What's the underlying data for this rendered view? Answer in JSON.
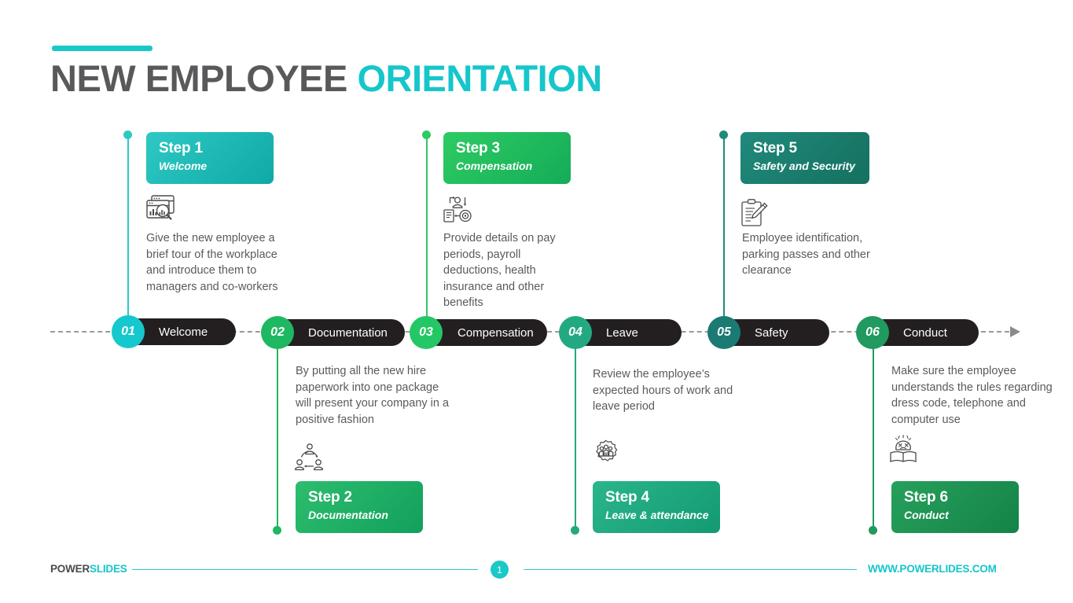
{
  "header": {
    "title_dark": "NEW EMPLOYEE",
    "title_accent": "ORIENTATION"
  },
  "theme": {
    "accent_cyan": "#15c6cb",
    "pill_dark": "#231f20",
    "body_text": "#585b5e",
    "axis_gray": "#9a9a9a"
  },
  "timeline": {
    "nodes": [
      {
        "num": "01",
        "label": "Welcome",
        "color": "#15c8cd"
      },
      {
        "num": "02",
        "label": "Documentation",
        "color": "#1fb862"
      },
      {
        "num": "03",
        "label": "Compensation",
        "color": "#23c765"
      },
      {
        "num": "04",
        "label": "Leave",
        "color": "#23a982"
      },
      {
        "num": "05",
        "label": "Safety",
        "color": "#1b7a74"
      },
      {
        "num": "06",
        "label": "Conduct",
        "color": "#209a5e"
      }
    ]
  },
  "steps": [
    {
      "card_title": "Step 1",
      "card_sub": "Welcome",
      "desc": "Give the new employee a brief tour of the workplace and introduce them to managers and co-workers",
      "icon": "window-search-chart-icon",
      "color_from": "#2ec9c4",
      "color_to": "#10a9a6",
      "position": "above"
    },
    {
      "card_title": "Step 2",
      "card_sub": "Documentation",
      "desc": "By putting all the new hire paperwork into one package will present your company in a positive fashion",
      "icon": "people-network-icon",
      "color_from": "#2dbd6e",
      "color_to": "#12a05c",
      "position": "below"
    },
    {
      "card_title": "Step 3",
      "card_sub": "Compensation",
      "desc": "Provide details on pay periods, payroll deductions, health insurance and other benefits",
      "icon": "person-gear-document-icon",
      "color_from": "#2ecb63",
      "color_to": "#14ac58",
      "position": "above"
    },
    {
      "card_title": "Step 4",
      "card_sub": "Leave & attendance",
      "desc": "Review the employee’s expected hours of work and leave period",
      "icon": "gear-people-icon",
      "color_from": "#2bb58b",
      "color_to": "#139a73",
      "position": "below"
    },
    {
      "card_title": "Step 5",
      "card_sub": "Safety and Security",
      "desc": "Employee identification, parking passes and other clearance",
      "icon": "clipboard-pencil-icon",
      "color_from": "#208a7c",
      "color_to": "#15705f",
      "position": "above"
    },
    {
      "card_title": "Step 6",
      "card_sub": "Conduct",
      "desc": "Make sure the employee understands the rules regarding dress code, telephone and computer use",
      "icon": "book-head-icon",
      "color_from": "#27a05c",
      "color_to": "#148347",
      "position": "below"
    }
  ],
  "footer": {
    "logo_dark": "POWER",
    "logo_accent": "SLIDES",
    "page_number": "1",
    "url": "WWW.POWERLIDES.COM"
  }
}
